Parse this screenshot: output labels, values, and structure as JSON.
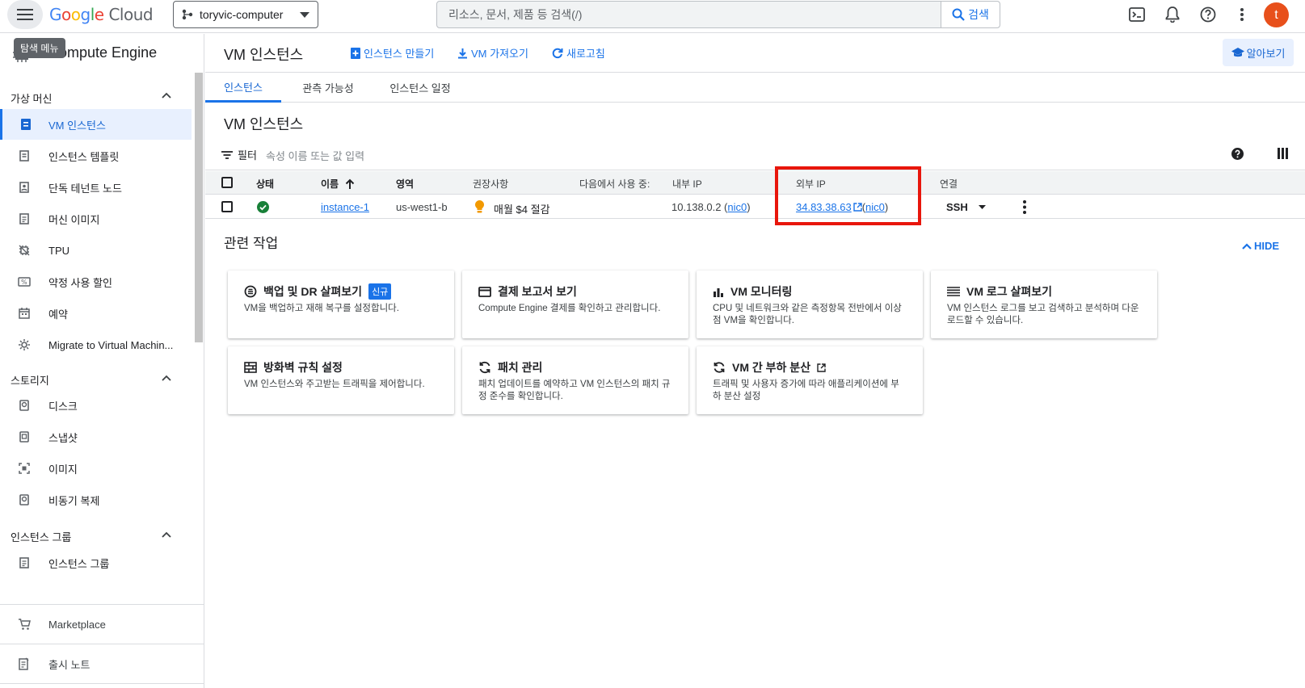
{
  "topbar": {
    "menu_tooltip": "탐색 메뉴",
    "logo": {
      "g1": "G",
      "o1": "o",
      "o2": "o",
      "g2": "g",
      "l": "l",
      "e": "e",
      "cloud": "Cloud"
    },
    "project": "toryvic-computer",
    "search_placeholder": "리소스, 문서, 제품 등 검색(/)",
    "search_button": "검색",
    "avatar_initial": "t"
  },
  "sidebar": {
    "title": "Compute Engine",
    "sections": {
      "vm": "가상 머신",
      "storage": "스토리지",
      "instance_groups": "인스턴스 그룹"
    },
    "items": [
      {
        "label": "VM 인스턴스"
      },
      {
        "label": "인스턴스 템플릿"
      },
      {
        "label": "단독 테넌트 노드"
      },
      {
        "label": "머신 이미지"
      },
      {
        "label": "TPU"
      },
      {
        "label": "약정 사용 할인"
      },
      {
        "label": "예약"
      },
      {
        "label": "Migrate to Virtual Machin..."
      },
      {
        "label": "디스크"
      },
      {
        "label": "스냅샷"
      },
      {
        "label": "이미지"
      },
      {
        "label": "비동기 복제"
      },
      {
        "label": "인스턴스 그룹"
      }
    ],
    "footer": {
      "marketplace": "Marketplace",
      "release_notes": "출시 노트"
    }
  },
  "header": {
    "title": "VM 인스턴스",
    "create": "인스턴스 만들기",
    "import": "VM 가져오기",
    "refresh": "새로고침",
    "learn": "알아보기"
  },
  "tabs": [
    "인스턴스",
    "관측 가능성",
    "인스턴스 일정"
  ],
  "section_title": "VM 인스턴스",
  "filter": {
    "label": "필터",
    "placeholder": "속성 이름 또는 값 입력"
  },
  "table": {
    "columns": [
      "상태",
      "이름",
      "영역",
      "권장사항",
      "다음에서 사용 중:",
      "내부 IP",
      "외부 IP",
      "연결"
    ],
    "rows": [
      {
        "name": "instance-1",
        "zone": "us-west1-b",
        "recommendation": "매월 $4 절감",
        "internal_ip": "10.138.0.2 (",
        "internal_nic": "nic0",
        "internal_close": ")",
        "external_ip": "34.83.38.63",
        "external_open": " (",
        "external_nic": "nic0",
        "external_close": ")",
        "connect": "SSH"
      }
    ]
  },
  "related": {
    "title": "관련 작업",
    "hide": "HIDE",
    "new_badge": "신규",
    "cards": [
      {
        "title": "백업 및 DR 살펴보기",
        "desc": "VM을 백업하고 재해 복구를 설정합니다."
      },
      {
        "title": "결제 보고서 보기",
        "desc": "Compute Engine 결제를 확인하고 관리합니다."
      },
      {
        "title": "VM 모니터링",
        "desc": "CPU 및 네트워크와 같은 측정항목 전반에서 이상점 VM을 확인합니다."
      },
      {
        "title": "VM 로그 살펴보기",
        "desc": "VM 인스턴스 로그를 보고 검색하고 분석하며 다운로드할 수 있습니다."
      },
      {
        "title": "방화벽 규칙 설정",
        "desc": "VM 인스턴스와 주고받는 트래픽을 제어합니다."
      },
      {
        "title": "패치 관리",
        "desc": "패치 업데이트를 예약하고 VM 인스턴스의 패치 규정 준수를 확인합니다."
      },
      {
        "title": "VM 간 부하 분산",
        "desc": "트래픽 및 사용자 증가에 따라 애플리케이션에 부하 분산 설정"
      }
    ]
  },
  "colors": {
    "accent": "#1a73e8",
    "highlight": "#e8160c",
    "status_ok": "#188038",
    "recommend": "#f29900"
  }
}
